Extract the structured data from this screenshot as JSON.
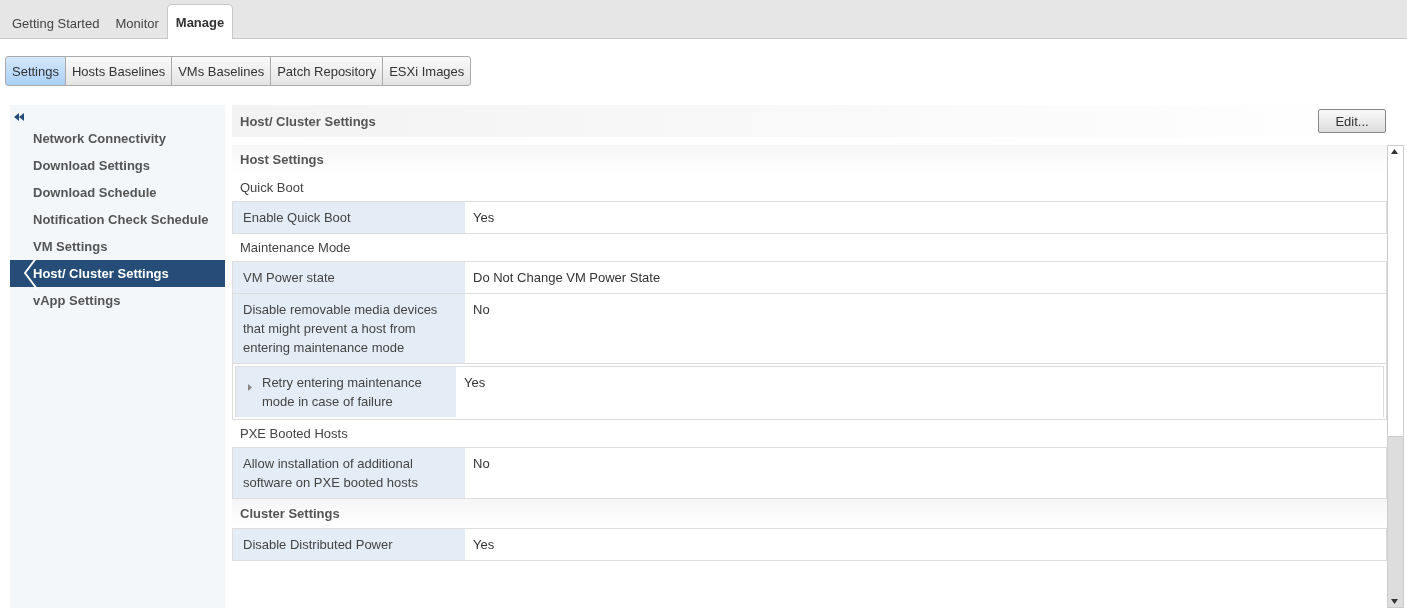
{
  "top_tabs": [
    {
      "label": "Getting Started",
      "selected": false
    },
    {
      "label": "Monitor",
      "selected": false
    },
    {
      "label": "Manage",
      "selected": true
    }
  ],
  "sub_tabs": [
    {
      "label": "Settings",
      "selected": true
    },
    {
      "label": "Hosts Baselines",
      "selected": false
    },
    {
      "label": "VMs Baselines",
      "selected": false
    },
    {
      "label": "Patch Repository",
      "selected": false
    },
    {
      "label": "ESXi Images",
      "selected": false
    }
  ],
  "sidebar": {
    "items": [
      {
        "label": "Network Connectivity",
        "selected": false
      },
      {
        "label": "Download Settings",
        "selected": false
      },
      {
        "label": "Download Schedule",
        "selected": false
      },
      {
        "label": "Notification Check Schedule",
        "selected": false
      },
      {
        "label": "VM Settings",
        "selected": false
      },
      {
        "label": "Host/ Cluster Settings",
        "selected": true
      },
      {
        "label": "vApp Settings",
        "selected": false
      }
    ]
  },
  "panel": {
    "title": "Host/ Cluster Settings",
    "edit_button": "Edit...",
    "items": [
      {
        "kind": "section",
        "title": "Host Settings"
      },
      {
        "kind": "group",
        "title": "Quick Boot"
      },
      {
        "kind": "table",
        "rows": [
          {
            "label": "Enable Quick Boot",
            "value": "Yes"
          }
        ]
      },
      {
        "kind": "group",
        "title": "Maintenance Mode"
      },
      {
        "kind": "table",
        "rows": [
          {
            "label": "VM Power state",
            "value": "Do Not Change VM Power State"
          },
          {
            "label": "Disable removable media devices that might prevent a host from entering maintenance mode",
            "value": "No"
          },
          {
            "label": "Retry entering maintenance mode in case of failure",
            "value": "Yes",
            "expandable": true
          }
        ]
      },
      {
        "kind": "group",
        "title": "PXE Booted Hosts"
      },
      {
        "kind": "table",
        "rows": [
          {
            "label": "Allow installation of additional software on PXE booted hosts",
            "value": "No"
          }
        ]
      },
      {
        "kind": "section",
        "title": "Cluster Settings"
      },
      {
        "kind": "table",
        "rows": [
          {
            "label": "Disable Distributed Power",
            "value": "Yes"
          }
        ]
      }
    ]
  }
}
